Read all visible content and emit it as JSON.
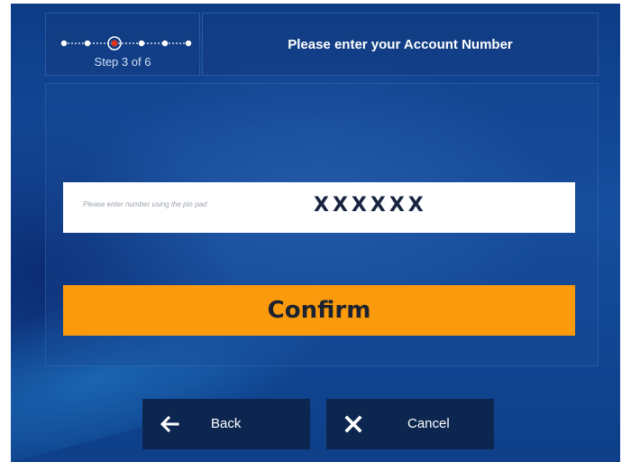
{
  "header": {
    "title": "Please enter your Account Number",
    "step_label": "Step 3 of 6",
    "step_current": 3,
    "step_total": 6
  },
  "account_input": {
    "hint": "Please enter number using the pin pad",
    "value": "XXXXXX"
  },
  "actions": {
    "confirm_label": "Confirm",
    "back_label": "Back",
    "cancel_label": "Cancel"
  },
  "colors": {
    "confirm_bg": "#fb9a0c",
    "footer_button_bg": "#0c2650",
    "active_step": "#e0301e"
  },
  "icons": {
    "back": "arrow-left-icon",
    "cancel": "close-icon"
  }
}
